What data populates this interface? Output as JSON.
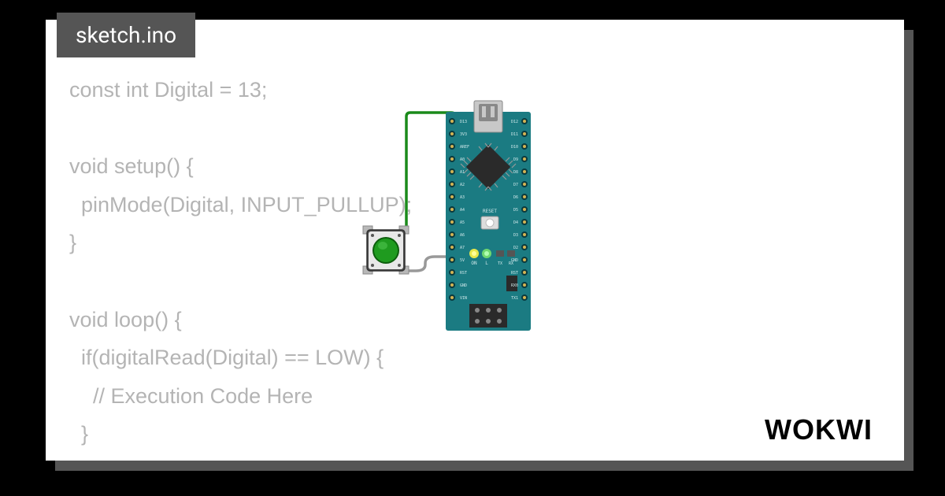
{
  "tab": {
    "filename": "sketch.ino"
  },
  "code": {
    "line1": "const int Digital = 13;",
    "line2": "",
    "line3": "void setup() {",
    "line4": "  pinMode(Digital, INPUT_PULLUP);",
    "line5": "}",
    "line6": "",
    "line7": "void loop() {",
    "line8": "  if(digitalRead(Digital) == LOW) {",
    "line9": "    // Execution Code Here",
    "line10": "  }"
  },
  "brand": {
    "name": "WOKWI"
  },
  "board": {
    "type": "arduino-nano",
    "color": "#1b7b82",
    "labels": {
      "reset": "RESET",
      "on": "ON",
      "l": "L",
      "tx": "TX",
      "rx": "RX"
    }
  },
  "component": {
    "type": "pushbutton",
    "cap_color": "#1f9b1f"
  },
  "wires": [
    {
      "from": "button-pin-top",
      "to": "nano-d13",
      "color": "#1a8a1a"
    },
    {
      "from": "button-pin-bottom",
      "to": "nano-gnd",
      "color": "#999999"
    }
  ]
}
